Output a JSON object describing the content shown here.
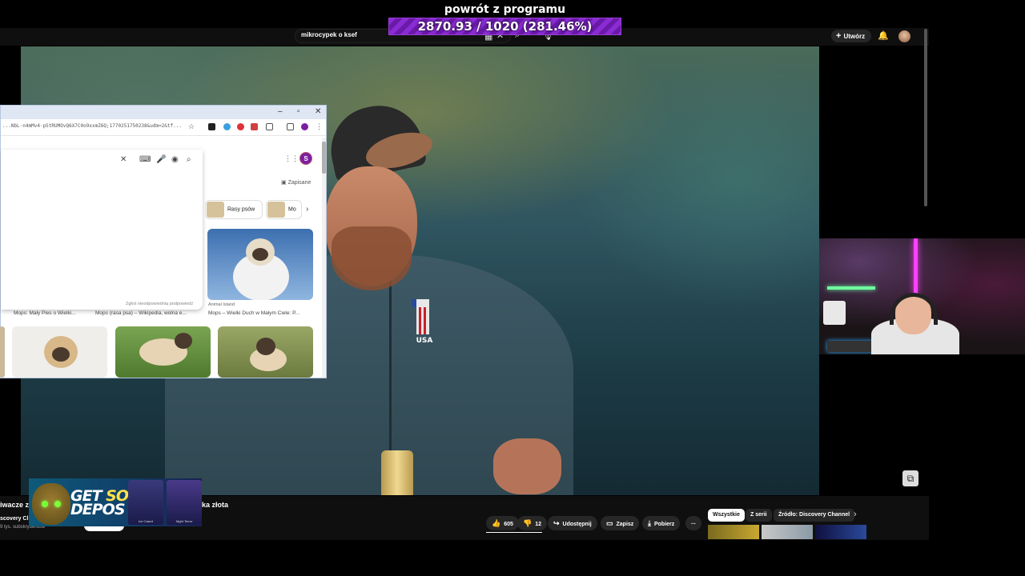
{
  "overlay": {
    "goal_title": "powrót z programu",
    "goal_progress_text": "2870.93 / 1020 (281.46%)",
    "accent": "#8a2bd4"
  },
  "youtube": {
    "search_value": "mikrocypek o ksef",
    "create_label": "Utwórz",
    "video_title_left": "iwacze z",
    "video_title_right": "ka złota",
    "channel_name": "scovery Cl",
    "subscribers": "9 tys. subskrybentów",
    "actions": {
      "like_count": "605",
      "dislike_count": "12",
      "share_label": "Udostępnij",
      "save_label": "Zapisz",
      "download_label": "Pobierz",
      "more": "..."
    },
    "filters": [
      "Wszystkie",
      "Z serii",
      "Źródło: Discovery Channel"
    ]
  },
  "browser": {
    "url": "...NbL·n4mMv4·pStRUMOvQ6X7C0o9xxmZ6Q;1770251750238&udm=2&tf...",
    "profile_initial": "S",
    "saved_label": "Zapisane",
    "chip_label_1": "Rasy psów",
    "chip_label_2": "Mo",
    "results_note": "Zgłoś nieodpowiednią podpowiedź",
    "captions": {
      "left_1": "Mops: Mały Pies o Wielki...",
      "left_2": "Mops (rasa psa) – Wikipedia, wolna e...",
      "right_source": "Animal Island",
      "right_title": "Mops – Wielki Duch w Małym Ciele: P..."
    }
  },
  "ad": {
    "line1_white": "GET ",
    "line1_accent": "SO",
    "line2_white": "DEPOS",
    "case_1": "Ice Cased",
    "case_2": "Night Terror"
  },
  "video": {
    "patch_text": "USA"
  }
}
